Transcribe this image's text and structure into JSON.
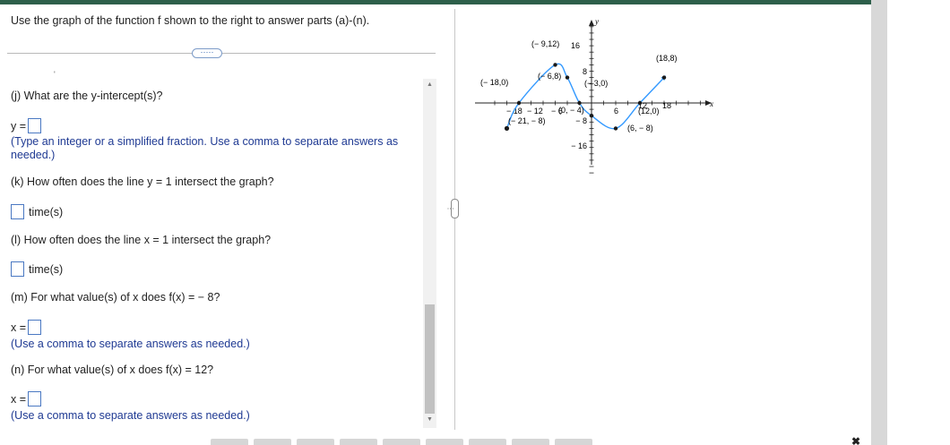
{
  "instructions": "Use the graph of the function f shown to the right to answer parts (a)-(n).",
  "more_button": "·····",
  "stray_mark": "'",
  "questions": {
    "j": {
      "prompt": "(j) What are the y-intercept(s)?",
      "answer_prefix": "y =",
      "hint": "(Type an integer or a simplified fraction. Use a comma to separate answers as needed.)"
    },
    "k": {
      "prompt": "(k) How often does the line y = 1 intersect the graph?",
      "answer_suffix": "time(s)"
    },
    "l": {
      "prompt": "(l) How often does the line x = 1 intersect the graph?",
      "answer_suffix": "time(s)"
    },
    "m": {
      "prompt": "(m) For what value(s) of x does f(x) = − 8?",
      "answer_prefix": "x =",
      "hint": "(Use a comma to separate answers as needed.)"
    },
    "n": {
      "prompt": "(n) For what value(s) of x does f(x) = 12?",
      "answer_prefix": "x =",
      "hint": "(Use a comma to separate answers as needed.)"
    }
  },
  "graph": {
    "y_axis_label": "y",
    "x_axis_label": "x",
    "y_tick_labels": [
      "16",
      "8",
      "− 8",
      "− 16"
    ],
    "x_tick_labels": [
      "− 18",
      "− 12",
      "− 6",
      "6",
      "12",
      "18"
    ],
    "point_labels": {
      "p_m18_0": "(− 18,0)",
      "p_m9_12": "(− 9,12)",
      "p_m6_8": "(− 6,8)",
      "p_m3_0": "(− 3,0)",
      "p_0_m4": "(0, − 4)",
      "p_m21_m8": "(− 21, − 8)",
      "p_6_m8": "(6, − 8)",
      "p_12_0": "(12,0)",
      "p_18_8": "(18,8)"
    },
    "points": [
      [
        -21,
        -8
      ],
      [
        -18,
        0
      ],
      [
        -9,
        12
      ],
      [
        -6,
        8
      ],
      [
        -3,
        0
      ],
      [
        0,
        -4
      ],
      [
        6,
        -8
      ],
      [
        12,
        0
      ],
      [
        18,
        8
      ]
    ],
    "curve_color": "#3399ff"
  },
  "colors": {
    "accent": "#1f3a93",
    "box_border": "#4a78c2",
    "top_bar": "#2d5f4a"
  }
}
